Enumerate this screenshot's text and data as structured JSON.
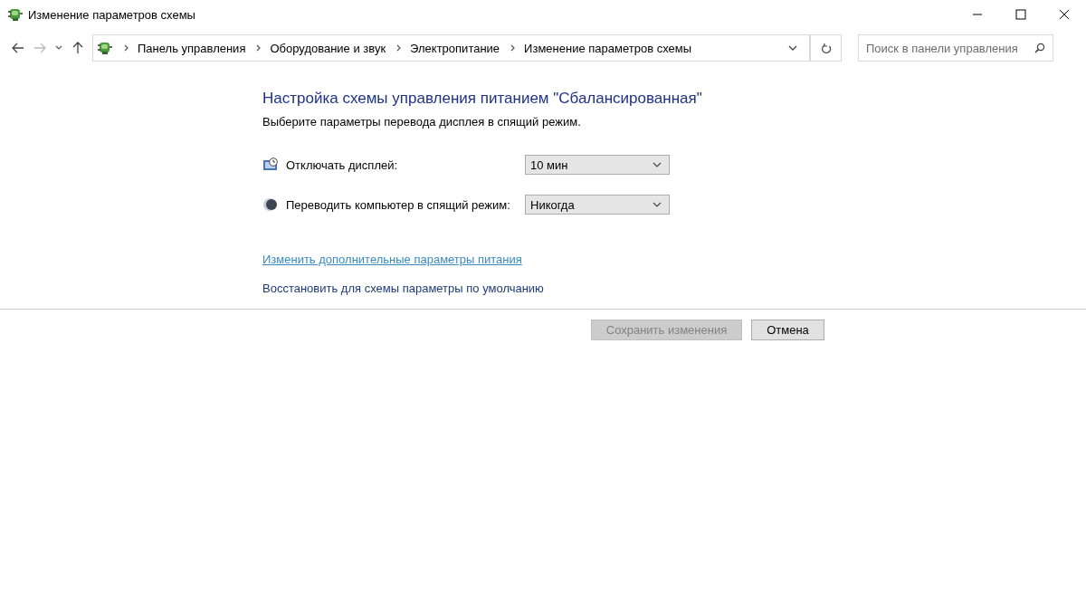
{
  "window": {
    "title": "Изменение параметров схемы"
  },
  "navigation": {
    "back_disabled": false,
    "forward_disabled": true
  },
  "address_bar": {
    "crumbs": [
      "Панель управления",
      "Оборудование и звук",
      "Электропитание",
      "Изменение параметров схемы"
    ]
  },
  "search": {
    "placeholder": "Поиск в панели управления"
  },
  "content": {
    "heading": "Настройка схемы управления питанием \"Сбалансированная\"",
    "subheading": "Выберите параметры перевода дисплея в спящий режим.",
    "settings": [
      {
        "kind": "display",
        "label": "Отключать дисплей:",
        "value": "10 мин"
      },
      {
        "kind": "sleep",
        "label": "Переводить компьютер в спящий режим:",
        "value": "Никогда"
      }
    ],
    "links": [
      {
        "text": "Изменить дополнительные параметры питания",
        "hovered": true
      },
      {
        "text": "Восстановить для схемы параметры по умолчанию",
        "hovered": false
      }
    ]
  },
  "buttons": [
    {
      "label": "Сохранить изменения",
      "disabled": true
    },
    {
      "label": "Отмена",
      "disabled": false
    }
  ]
}
